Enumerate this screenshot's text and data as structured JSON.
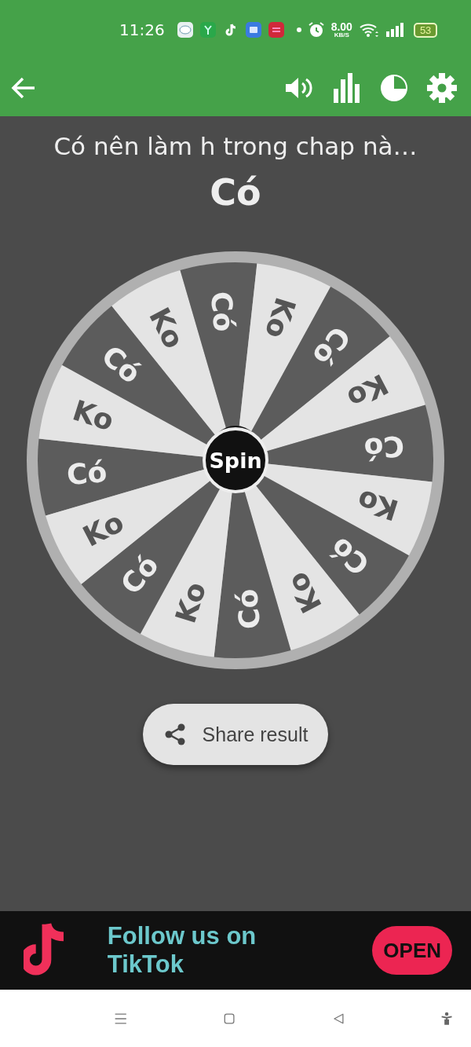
{
  "status_bar": {
    "time": "11:26",
    "speed": "8.00",
    "speed_unit": "KB/S",
    "battery": "53"
  },
  "question": "Có nên làm h trong chap nà…",
  "result": "Có",
  "wheel": {
    "spin_label": "Spin",
    "segments": [
      {
        "label": "Có",
        "color": "#5c5c5c"
      },
      {
        "label": "Ko",
        "color": "#e4e4e4"
      },
      {
        "label": "Có",
        "color": "#5c5c5c"
      },
      {
        "label": "Ko",
        "color": "#e4e4e4"
      },
      {
        "label": "Có",
        "color": "#5c5c5c"
      },
      {
        "label": "Ko",
        "color": "#e4e4e4"
      },
      {
        "label": "Có",
        "color": "#5c5c5c"
      },
      {
        "label": "Ko",
        "color": "#e4e4e4"
      },
      {
        "label": "Có",
        "color": "#5c5c5c"
      },
      {
        "label": "Ko",
        "color": "#e4e4e4"
      },
      {
        "label": "Có",
        "color": "#5c5c5c"
      },
      {
        "label": "Ko",
        "color": "#e4e4e4"
      },
      {
        "label": "Có",
        "color": "#5c5c5c"
      },
      {
        "label": "Ko",
        "color": "#e4e4e4"
      },
      {
        "label": "Có",
        "color": "#5c5c5c"
      },
      {
        "label": "Ko",
        "color": "#e4e4e4"
      }
    ]
  },
  "share_button": "Share result",
  "ad": {
    "text": "Follow us on TikTok",
    "button": "OPEN"
  }
}
